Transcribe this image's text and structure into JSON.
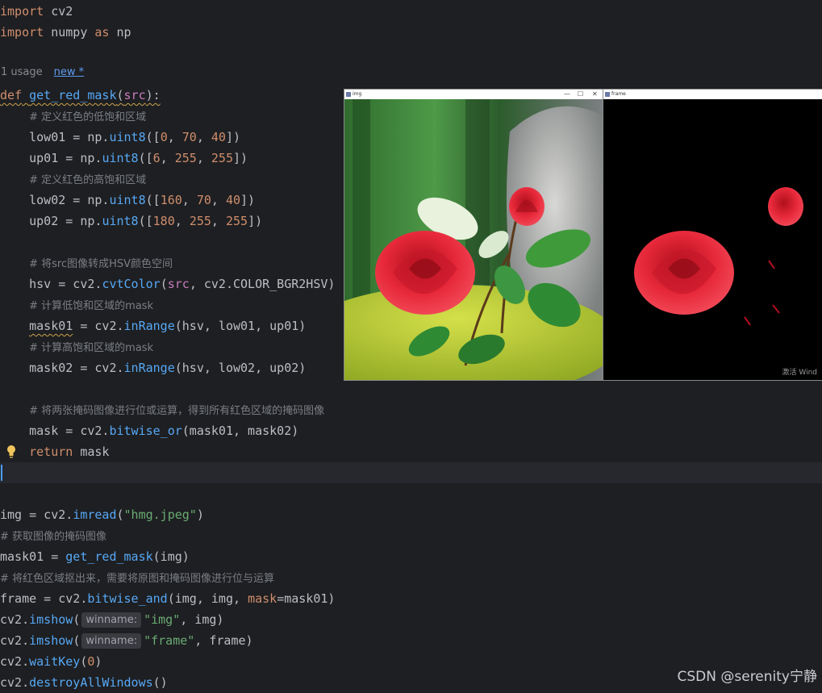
{
  "code": {
    "l1": {
      "kw": "import",
      "rest": " cv2"
    },
    "l2": {
      "kw": "import",
      "mid": " numpy ",
      "kw2": "as",
      "rest": " np"
    },
    "usage": {
      "count": "1 usage",
      "new": "new *"
    },
    "l4": {
      "kw": "def",
      "sp": " ",
      "fn": "get_red_mask",
      "open": "(",
      "param": "src",
      "close": "):"
    },
    "l5": {
      "indent": "    ",
      "comment": "# 定义红色的低饱和区域"
    },
    "l6": {
      "pre": "    low01 = np.",
      "fn": "uint8",
      "o": "([",
      "n1": "0",
      "c1": ", ",
      "n2": "70",
      "c2": ", ",
      "n3": "40",
      "e": "])"
    },
    "l7": {
      "pre": "    up01 = np.",
      "fn": "uint8",
      "o": "([",
      "n1": "6",
      "c1": ", ",
      "n2": "255",
      "c2": ", ",
      "n3": "255",
      "e": "])"
    },
    "l8": {
      "indent": "    ",
      "comment": "# 定义红色的高饱和区域"
    },
    "l9": {
      "pre": "    low02 = np.",
      "fn": "uint8",
      "o": "([",
      "n1": "160",
      "c1": ", ",
      "n2": "70",
      "c2": ", ",
      "n3": "40",
      "e": "])"
    },
    "l10": {
      "pre": "    up02 = np.",
      "fn": "uint8",
      "o": "([",
      "n1": "180",
      "c1": ", ",
      "n2": "255",
      "c2": ", ",
      "n3": "255",
      "e": "])"
    },
    "l12": {
      "indent": "    ",
      "comment": "# 将src图像转成HSV颜色空间"
    },
    "l13": {
      "pre": "    hsv = cv2.",
      "fn": "cvtColor",
      "o": "(",
      "p": "src",
      "rest": ", cv2.COLOR_BGR2HSV)"
    },
    "l14": {
      "indent": "    ",
      "comment": "# 计算低饱和区域的mask"
    },
    "l15": {
      "indent": "    ",
      "var": "mask01",
      "pre": " = cv2.",
      "fn": "inRange",
      "rest": "(hsv, low01, up01)"
    },
    "l16": {
      "indent": "    ",
      "comment": "# 计算高饱和区域的mask"
    },
    "l17": {
      "pre": "    mask02 = cv2.",
      "fn": "inRange",
      "rest": "(hsv, low02, up02)"
    },
    "l19": {
      "indent": "    ",
      "comment": "# 将两张掩码图像进行位或运算，得到所有红色区域的掩码图像"
    },
    "l20": {
      "pre": "    mask = cv2.",
      "fn": "bitwise_or",
      "rest": "(mask01, mask02)"
    },
    "l21": {
      "indent": "    ",
      "kw": "return",
      "rest": " mask"
    },
    "l24": {
      "pre": "img = cv2.",
      "fn": "imread",
      "o": "(",
      "str": "\"hmg.jpeg\"",
      "e": ")"
    },
    "l25": {
      "comment": "# 获取图像的掩码图像"
    },
    "l26": {
      "pre": "mask01 = ",
      "fn": "get_red_mask",
      "rest": "(img)"
    },
    "l27": {
      "comment": "# 将红色区域抠出来，需要将原图和掩码图像进行位与运算"
    },
    "l28": {
      "pre": "frame = cv2.",
      "fn": "bitwise_and",
      "mid": "(img, img, ",
      "kw": "mask",
      "rest": "=mask01)"
    },
    "l29": {
      "pre": "cv2.",
      "fn": "imshow",
      "o": "(",
      "hint": "winname:",
      "str": "\"img\"",
      "rest": ", img)"
    },
    "l30": {
      "pre": "cv2.",
      "fn": "imshow",
      "o": "(",
      "hint": "winname:",
      "str": "\"frame\"",
      "rest": ", frame)"
    },
    "l31": {
      "pre": "cv2.",
      "fn": "waitKey",
      "o": "(",
      "num": "0",
      "e": ")"
    },
    "l32": {
      "pre": "cv2.",
      "fn": "destroyAllWindows",
      "e": "()"
    }
  },
  "windows": {
    "img": {
      "title": "img",
      "min": "—",
      "max": "☐",
      "close": "✕"
    },
    "frame": {
      "title": "frame",
      "watermark": "激活 Wind"
    }
  },
  "colors": {
    "bg": "#1e1f22",
    "keyword": "#cf8e6d",
    "function": "#56a8f5",
    "string": "#6aab73",
    "number": "#2aacb8",
    "comment": "#7a7e85"
  },
  "footer": {
    "credit": "CSDN @serenity宁静"
  }
}
